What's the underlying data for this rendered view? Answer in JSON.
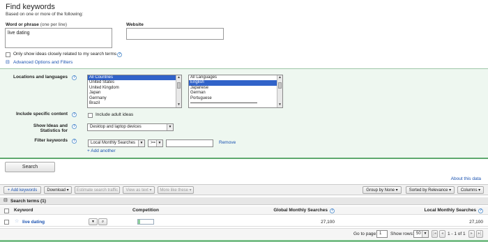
{
  "form": {
    "title": "Find keywords",
    "subtitle": "Based on one or more of the following:",
    "word_label": "Word or phrase",
    "word_hint": "(one per line)",
    "word_value": "live dating",
    "website_label": "Website",
    "only_show_label": "Only show ideas closely related to my search terms",
    "advanced_label": "Advanced Options and Filters",
    "advanced_symbol": "⊟"
  },
  "advanced": {
    "locations_label": "Locations and languages",
    "countries": [
      "All Countries",
      "United States",
      "United Kingdom",
      "Japan",
      "Germany",
      "Brazil"
    ],
    "languages": [
      "All Languages",
      "English",
      "Japanese",
      "German",
      "Portuguese"
    ],
    "include_label": "Include specific content",
    "adult_label": "Include adult ideas",
    "show_ideas_label_1": "Show Ideas and",
    "show_ideas_label_2": "Statistics for",
    "device_value": "Desktop and laptop devices",
    "filter_label": "Filter keywords",
    "filter_metric": "Local Monthly Searches",
    "filter_operator": ">=",
    "remove_label": "Remove",
    "add_another_label": "+ Add another"
  },
  "search_button": "Search",
  "about_link": "About this data",
  "help_glyph": "?",
  "toolbar": {
    "add_keywords": "+ Add keywords",
    "download": "Download",
    "estimate": "Estimate search traffic",
    "view_as_text": "View as text",
    "more_like_these": "More like these",
    "group_by": "Group by None",
    "sorted_by": "Sorted by Relevance",
    "columns": "Columns"
  },
  "table": {
    "section_title": "Search terms (1)",
    "section_symbol": "⊟",
    "headers": {
      "keyword": "Keyword",
      "competition": "Competition",
      "global": "Global Monthly Searches",
      "local": "Local Monthly Searches"
    },
    "rows": [
      {
        "keyword": "live dating",
        "competition": 0.12,
        "global": "27,100",
        "local": "27,100"
      }
    ]
  },
  "pager": {
    "goto_label": "Go to page:",
    "goto_value": "1",
    "show_rows_label": "Show rows:",
    "rows_value": "50",
    "range": "1 - 1 of 1"
  },
  "colors": {
    "panel_bg": "#eef7f0",
    "panel_border": "#5ea96e",
    "link": "#1a52b0",
    "selection": "#3163c9"
  }
}
